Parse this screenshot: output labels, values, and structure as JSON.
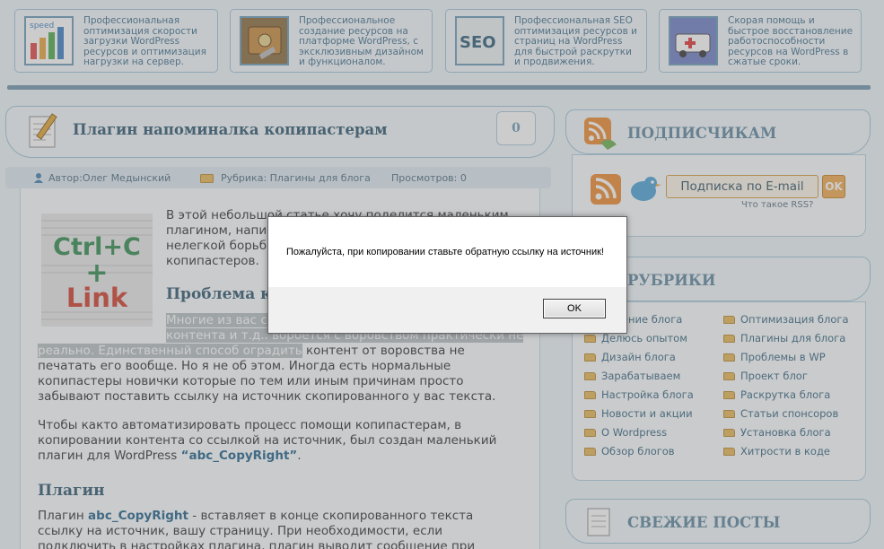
{
  "banner": [
    {
      "text": "Профессиональная оптимизация скорости загрузки WordPress ресурсов и оптимизация нагрузки на сервер.",
      "icon": "speed-chart-icon",
      "label": "speed"
    },
    {
      "text": "Профессиональное создание ресурсов на платформе WordPress, с эксклюзивным дизайном и функционалом.",
      "icon": "briefcase-icon"
    },
    {
      "text": "Профессиональная SEO оптимизация ресурсов и страниц на WordPress для быстрой раскрутки и продвижения.",
      "icon": "seo-icon",
      "label": "SEO"
    },
    {
      "text": "Скорая помощь и быстрое восстановление работоспособности ресурсов на WordPress в сжатые сроки.",
      "icon": "ambulance-icon"
    }
  ],
  "post": {
    "title": "Плагин напоминалка копипастерам",
    "comment_count": "0",
    "meta": {
      "author": "Автор:Олег Медынский",
      "category": "Рубрика: Плагины для блога",
      "views": "Просмотров: 0"
    },
    "image_text": {
      "l1": "Ctrl+C",
      "l2": "+",
      "l3": "Link"
    },
    "intro_lines": [
      "В этой небольшой статье хочу поделится маленьким",
      "плагином, напис",
      "нелегкой борьбе",
      "копипастеров."
    ],
    "heading1": "Проблема к",
    "p1_sel_a": "Многие из вас с",
    "p1_line2": "контента и т.д.. ворбется с воровством практически не",
    "p1_sel_b": "реально. Единственный способ оградить",
    "p1_rest": " контент от воровства не печатать его вообще. Но я не об этом. Иногда есть нормальные копипастеры новички которые по тем или иным причинам просто забывают поставить ссылку на источник скопированного у вас текста.",
    "p2_text": "Чтобы както автоматизировать процесс помощи копипастерам, в копировании контента со ссылкой на источник, был создан маленький плагин для WordPress ",
    "p2_link": "“abc_CopyRight”",
    "p2_end": ".",
    "heading2": "Плагин",
    "p3_start": "Плагин ",
    "p3_link": "abc_CopyRight",
    "p3_text": " - вставляет в конце скопированного текста ссылку на источник, вашу страницу. При необходимости, если подключить в настройках плагина, плагин выводит сообщение при копировании текста о"
  },
  "sidebar": {
    "subscribe": {
      "title": "ПОДПИСЧИКАМ",
      "email_label": "Подписка по E-mail",
      "ok_label": "OK",
      "rss_link": "Что такое RSS?"
    },
    "rubrics": {
      "title": "РУБРИКИ",
      "col1": [
        "Ведение блога",
        "Делюсь опытом",
        "Дизайн блога",
        "Зарабатываем",
        "Настройка блога",
        "Новости и акции",
        "О Wordpress",
        "Обзор блогов"
      ],
      "col2": [
        "Оптимизация блога",
        "Плагины для блога",
        "Проблемы в WP",
        "Проект блог",
        "Раскрутка блога",
        "Статьи спонсоров",
        "Установка блога",
        "Хитрости в коде"
      ]
    },
    "recent": {
      "title": "СВЕЖИЕ ПОСТЫ"
    }
  },
  "dialog": {
    "message": "Пожалуйста, при копировании ставьте обратную ссылку на источник!",
    "ok_label": "OK"
  }
}
